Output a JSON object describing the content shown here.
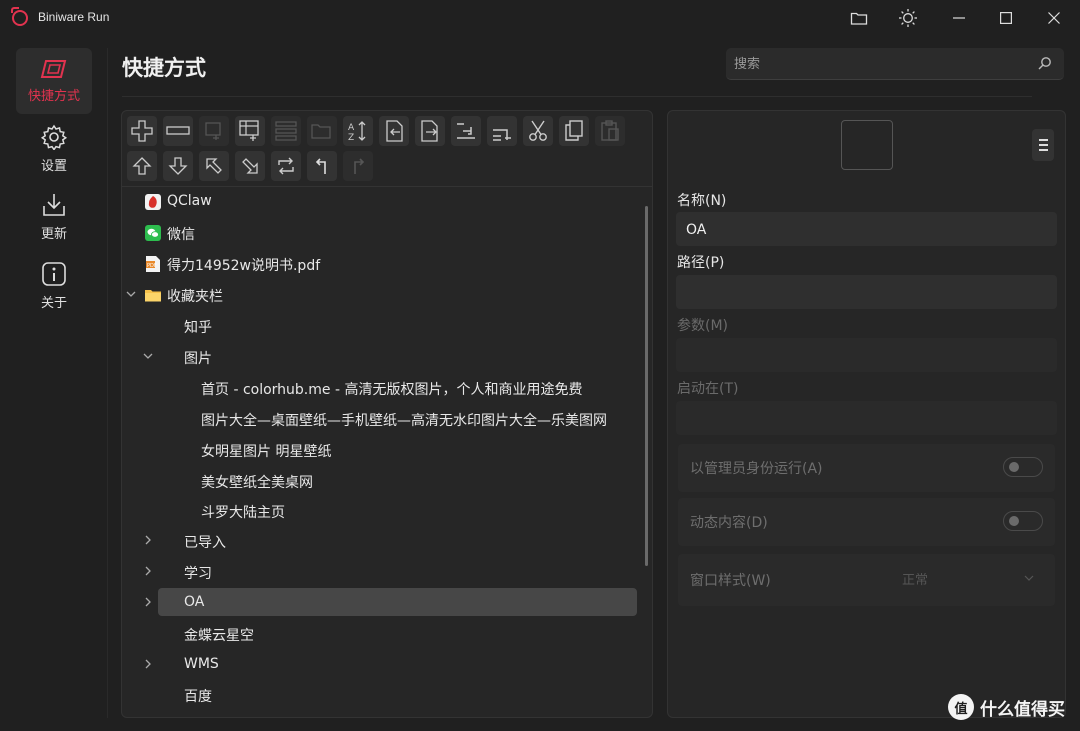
{
  "app": {
    "title": "Biniware Run"
  },
  "nav": [
    {
      "label": "快捷方式",
      "icon": "shortcut-icon",
      "active": true
    },
    {
      "label": "设置",
      "icon": "gear-icon"
    },
    {
      "label": "更新",
      "icon": "download-icon"
    },
    {
      "label": "关于",
      "icon": "info-icon"
    }
  ],
  "header": {
    "title": "快捷方式",
    "search_placeholder": "搜索"
  },
  "toolbar": {
    "row1": [
      "add-icon",
      "remove-icon",
      "add-folder-icon",
      "add-separator-icon",
      "list-icon",
      "open-folder-icon",
      "sort-icon",
      "import-icon",
      "export-icon",
      "indent-icon",
      "outdent-icon",
      "cut-icon",
      "copy-icon",
      "paste-icon"
    ],
    "row2": [
      "move-up-icon",
      "move-down-icon",
      "move-top-icon",
      "move-out-icon",
      "refresh-icon",
      "undo-icon",
      "redo-icon"
    ]
  },
  "tree": [
    {
      "label": "QClaw",
      "icon": "qclaw-app-icon"
    },
    {
      "label": "微信",
      "icon": "wechat-icon"
    },
    {
      "label": "得力14952w说明书.pdf",
      "icon": "pdf-file-icon"
    },
    {
      "label": "收藏夹栏",
      "icon": "folder-icon",
      "expanded": true
    },
    {
      "label": "知乎"
    },
    {
      "label": "图片",
      "expanded": true
    },
    {
      "label": "首页 - colorhub.me - 高清无版权图片，个人和商业用途免费"
    },
    {
      "label": "图片大全—桌面壁纸—手机壁纸—高清无水印图片大全—乐美图网"
    },
    {
      "label": "女明星图片 明星壁纸"
    },
    {
      "label": "美女壁纸全美桌网"
    },
    {
      "label": "斗罗大陆主页"
    },
    {
      "label": "已导入",
      "collapsed": true
    },
    {
      "label": "学习",
      "collapsed": true
    },
    {
      "label": "OA",
      "collapsed": true,
      "selected": true
    },
    {
      "label": "金蝶云星空"
    },
    {
      "label": "WMS",
      "collapsed": true
    },
    {
      "label": "百度"
    }
  ],
  "details": {
    "name_label": "名称(N)",
    "name_value": "OA",
    "path_label": "路径(P)",
    "path_value": "",
    "params_label": "参数(M)",
    "start_in_label": "启动在(T)",
    "run_as_admin_label": "以管理员身份运行(A)",
    "run_as_admin": false,
    "dynamic_content_label": "动态内容(D)",
    "dynamic_content": false,
    "window_style_label": "窗口样式(W)",
    "window_style_value": "正常"
  },
  "watermark": {
    "text": "什么值得买",
    "logo_char": "值"
  },
  "colors": {
    "accent": "#e2334f",
    "background": "#202020",
    "panel": "#262626"
  }
}
